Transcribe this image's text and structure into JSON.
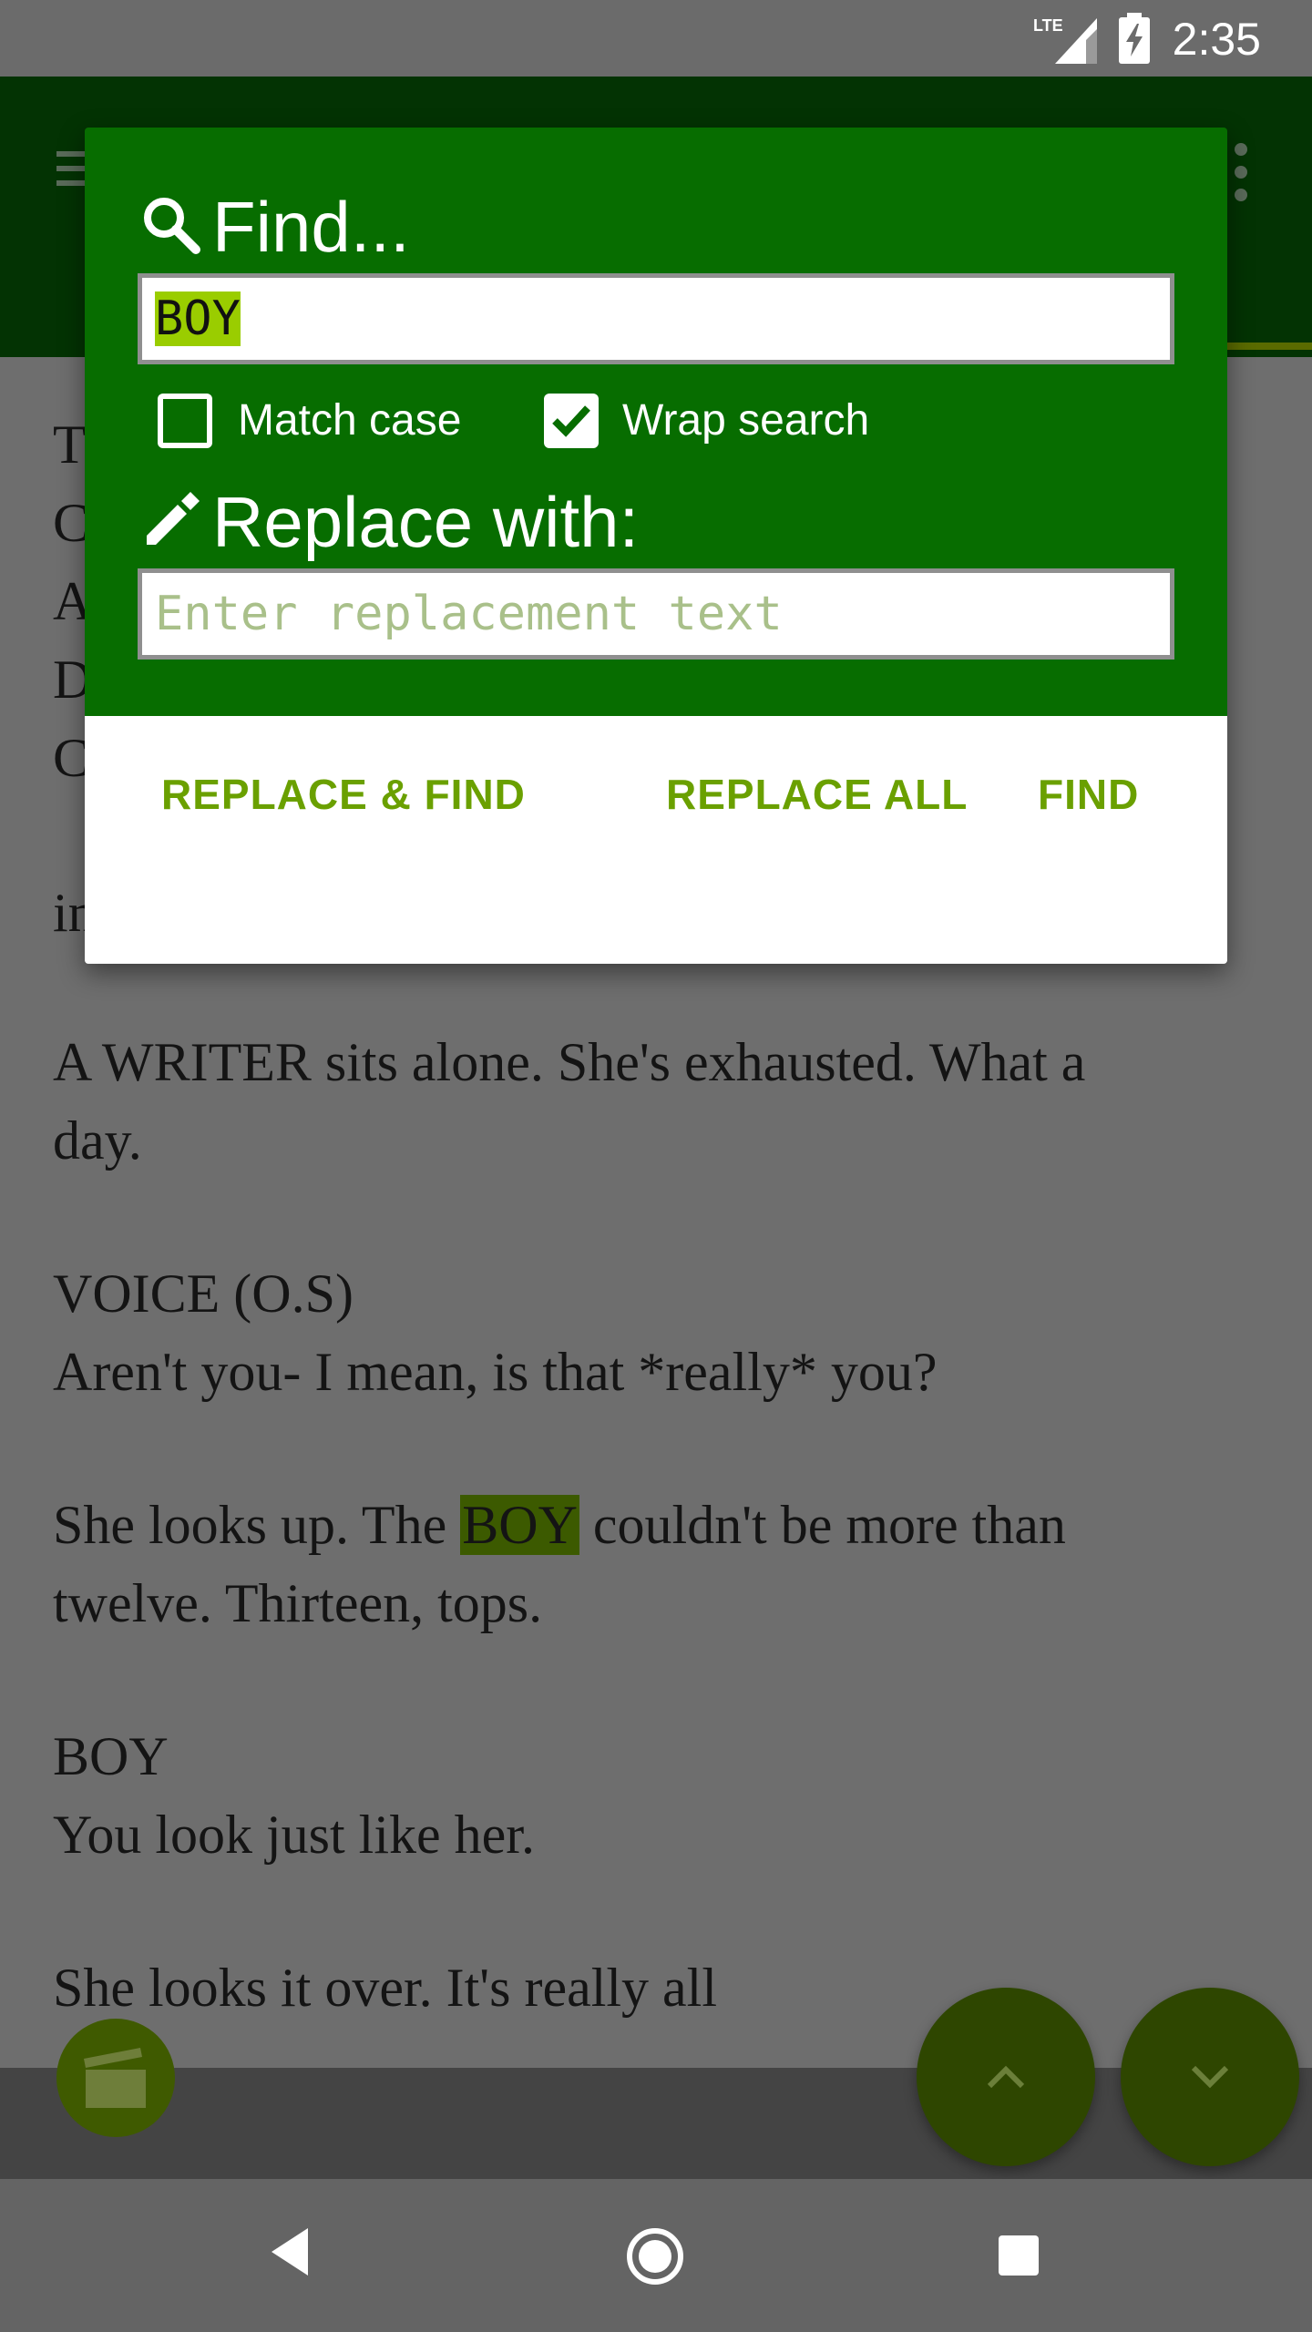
{
  "status_bar": {
    "time": "2:35",
    "network": "LTE"
  },
  "script_lines": [
    "T",
    "C",
    "A",
    "D",
    "C",
    "in",
    "A WRITER sits alone.  She's exhausted.  What a",
    "day.",
    "VOICE (O.S)",
    "Aren't you- I mean, is that *really* you?",
    "BOY",
    "You look just like her.",
    "She looks it over. It's really all"
  ],
  "highlight_line": {
    "before": "She looks up.  The ",
    "match": "BOY",
    "after": " couldn't be more than"
  },
  "highlight_line_2": "twelve.  Thirteen, tops.",
  "dialog": {
    "find_title": "Find...",
    "find_value": "BOY",
    "match_case": {
      "label": "Match case",
      "checked": false
    },
    "wrap_search": {
      "label": "Wrap search",
      "checked": true
    },
    "replace_title": "Replace with:",
    "replace_placeholder": "Enter replacement text",
    "buttons": {
      "replace_find": "REPLACE & FIND",
      "replace_all": "REPLACE ALL",
      "find": "FIND"
    }
  },
  "colors": {
    "dialog_header": "#076d00",
    "accent": "#6aa000",
    "selection": "#9acd00",
    "scrim": "#6e6e6e"
  },
  "icons": [
    "search-icon",
    "pencil-icon",
    "menu-icon",
    "overflow-icon",
    "clapperboard-icon",
    "chevron-up-icon",
    "chevron-down-icon",
    "back-icon",
    "home-icon",
    "recents-icon",
    "lte-signal-icon",
    "battery-charging-icon"
  ]
}
